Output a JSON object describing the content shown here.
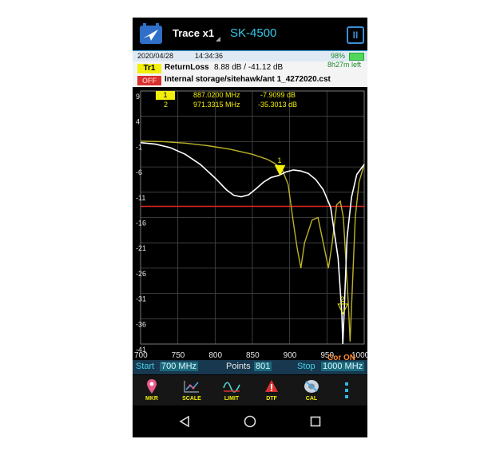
{
  "header": {
    "trace_title": "Trace x1",
    "device_name": "SK-4500",
    "pause_label": "II"
  },
  "status": {
    "date": "2020/04/28",
    "time": "14:34:36",
    "battery_percent": "98%",
    "time_left": "8h27m left"
  },
  "trace_info": {
    "badge": "Tr1",
    "measurement": "ReturnLoss",
    "values": "8.88 dB / -41.12 dB",
    "cal_badge": "OFF",
    "file_path": "Internal storage/sitehawk/ant 1_4272020.cst"
  },
  "markers": [
    {
      "num": "1",
      "freq": "887.0200 MHz",
      "value": "-7.9099 dB"
    },
    {
      "num": "2",
      "freq": "971.3315 MHz",
      "value": "-35.3013 dB"
    }
  ],
  "chart_data": {
    "type": "line",
    "xlim": [
      700,
      1000
    ],
    "ylim": [
      -41,
      9
    ],
    "x_ticks": [
      "700",
      "750",
      "800",
      "850",
      "900",
      "950",
      "1000"
    ],
    "y_ticks": [
      "9",
      "4",
      "-1",
      "-6",
      "-11",
      "-16",
      "-21",
      "-26",
      "-31",
      "-36",
      "-41"
    ],
    "limit_line": -13.8,
    "grid": true,
    "series": [
      {
        "color": "#ffffff",
        "points": [
          [
            700,
            -1.2
          ],
          [
            720,
            -1.5
          ],
          [
            740,
            -2.2
          ],
          [
            760,
            -3.5
          ],
          [
            780,
            -5.5
          ],
          [
            800,
            -8.2
          ],
          [
            815,
            -10.5
          ],
          [
            825,
            -11.6
          ],
          [
            835,
            -11.9
          ],
          [
            845,
            -11.5
          ],
          [
            855,
            -10.3
          ],
          [
            865,
            -9.0
          ],
          [
            875,
            -8.1
          ],
          [
            885,
            -7.7
          ],
          [
            895,
            -7.0
          ],
          [
            905,
            -6.6
          ],
          [
            915,
            -6.8
          ],
          [
            925,
            -7.3
          ],
          [
            935,
            -8.5
          ],
          [
            945,
            -10.5
          ],
          [
            955,
            -14.0
          ],
          [
            965,
            -24.0
          ],
          [
            970,
            -35.0
          ],
          [
            971.3,
            -41.0
          ],
          [
            973,
            -35.0
          ],
          [
            977,
            -20.0
          ],
          [
            983,
            -12.0
          ],
          [
            990,
            -7.5
          ],
          [
            1000,
            -5.5
          ]
        ]
      },
      {
        "color": "#bdb22a",
        "points": [
          [
            700,
            -0.9
          ],
          [
            730,
            -1.0
          ],
          [
            760,
            -1.3
          ],
          [
            790,
            -1.8
          ],
          [
            820,
            -2.5
          ],
          [
            850,
            -3.5
          ],
          [
            870,
            -4.5
          ],
          [
            880,
            -5.3
          ],
          [
            890,
            -6.5
          ],
          [
            898,
            -9.5
          ],
          [
            905,
            -17.0
          ],
          [
            910,
            -22.0
          ],
          [
            915,
            -26.0
          ],
          [
            920,
            -21.0
          ],
          [
            930,
            -16.5
          ],
          [
            938,
            -16.0
          ],
          [
            945,
            -21.0
          ],
          [
            952,
            -26.0
          ],
          [
            957,
            -21.0
          ],
          [
            963,
            -13.5
          ],
          [
            968,
            -12.8
          ],
          [
            972,
            -16.0
          ],
          [
            976,
            -26.0
          ],
          [
            979,
            -34.0
          ],
          [
            981,
            -40.5
          ],
          [
            984,
            -30.0
          ],
          [
            988,
            -16.0
          ],
          [
            993,
            -9.0
          ],
          [
            1000,
            -5.5
          ]
        ]
      }
    ],
    "marker_points": [
      {
        "label": "1",
        "x": 887.02,
        "y": -7.9099
      },
      {
        "label": "2",
        "x": 971.33,
        "y": -35.3013
      }
    ],
    "cor_label": "Cor ON"
  },
  "sweep": {
    "start_label": "Start",
    "start_value": "700 MHz",
    "points_label": "Points",
    "points_value": "801",
    "stop_label": "Stop",
    "stop_value": "1000 MHz"
  },
  "toolbar": {
    "items": [
      {
        "label": "MKR",
        "icon": "map-pin-icon"
      },
      {
        "label": "SCALE",
        "icon": "scale-graph-icon"
      },
      {
        "label": "LIMIT",
        "icon": "limit-wave-icon"
      },
      {
        "label": "DTF",
        "icon": "warning-triangle-icon"
      },
      {
        "label": "CAL",
        "icon": "calibration-disc-icon"
      }
    ],
    "more_icon": "more-vertical-icon"
  },
  "colors": {
    "accent": "#35c8e8",
    "marker_yellow": "#f2ef0a",
    "limit_red": "#e02525",
    "cor_orange": "#ff8a2a"
  }
}
